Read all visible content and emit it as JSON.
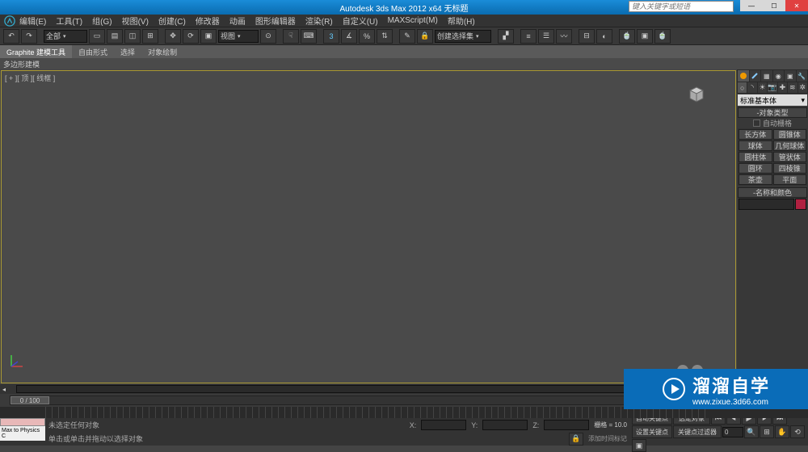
{
  "title": "Autodesk 3ds Max 2012 x64   无标题",
  "search_placeholder": "键入关键字或短语",
  "menu": [
    "编辑(E)",
    "工具(T)",
    "组(G)",
    "视图(V)",
    "创建(C)",
    "修改器",
    "动画",
    "图形编辑器",
    "渲染(R)",
    "自定义(U)",
    "MAXScript(M)",
    "帮助(H)"
  ],
  "toolbar1": {
    "selset_label": "全部",
    "view_label": "视图",
    "createsel_label": "创建选择集"
  },
  "ribbon": {
    "tabs": [
      "Graphite 建模工具",
      "自由形式",
      "选择",
      "对象绘制"
    ],
    "subtab": "多边形建模"
  },
  "viewport": {
    "label": "[ + ][ 顶 ][ 线框 ]"
  },
  "rpanel": {
    "dropdown": "标准基本体",
    "sec1": "对象类型",
    "autogrid": "自动栅格",
    "prims": [
      "长方体",
      "圆锥体",
      "球体",
      "几何球体",
      "圆柱体",
      "管状体",
      "圆环",
      "四棱锥",
      "茶壶",
      "平面"
    ],
    "sec2": "名称和颜色"
  },
  "timeline": {
    "thumb": "0 / 100"
  },
  "status": {
    "leftbtn": "Max to Physics C",
    "line1": "未选定任何对象",
    "line2": "单击或单击并拖动以选择对象",
    "x": "X:",
    "y": "Y:",
    "z": "Z:",
    "grid_label": "栅格 = 10.0",
    "addtime": "添加时间标记",
    "autokey": "自动关键点",
    "setkey": "设置关键点",
    "keyfilter": "关键点过滤器",
    "selected": "选定对象"
  },
  "watermark": {
    "big": "溜溜自学",
    "small": "www.zixue.3d66.com"
  }
}
